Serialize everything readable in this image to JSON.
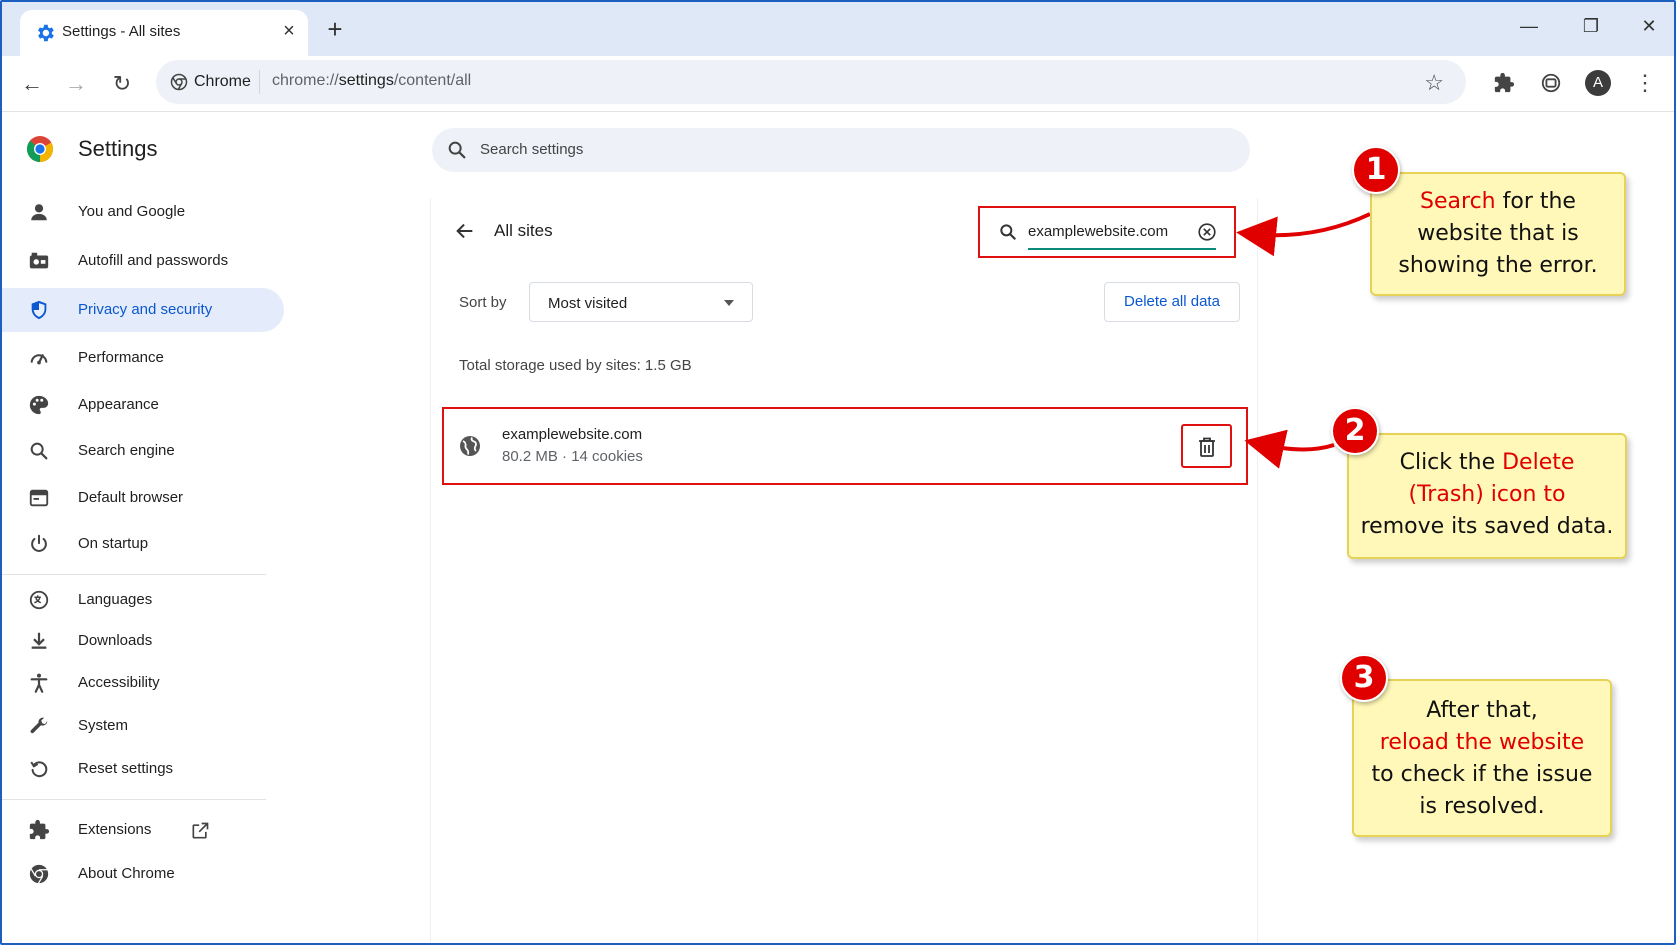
{
  "browser": {
    "tab_title": "Settings - All sites",
    "omnibox_chip": "Chrome",
    "url_prefix": "chrome://",
    "url_host": "settings",
    "url_path": "/content/all",
    "avatar_letter": "A"
  },
  "settings": {
    "title": "Settings",
    "search_placeholder": "Search settings",
    "sidebar": [
      {
        "label": "You and Google",
        "icon": "person-icon"
      },
      {
        "label": "Autofill and passwords",
        "icon": "autofill-icon"
      },
      {
        "label": "Privacy and security",
        "icon": "shield-icon",
        "active": true
      },
      {
        "label": "Performance",
        "icon": "speedometer-icon"
      },
      {
        "label": "Appearance",
        "icon": "palette-icon"
      },
      {
        "label": "Search engine",
        "icon": "search-icon"
      },
      {
        "label": "Default browser",
        "icon": "browser-window-icon"
      },
      {
        "label": "On startup",
        "icon": "power-icon"
      },
      {
        "label": "Languages",
        "icon": "translate-icon"
      },
      {
        "label": "Downloads",
        "icon": "download-icon"
      },
      {
        "label": "Accessibility",
        "icon": "accessibility-icon"
      },
      {
        "label": "System",
        "icon": "wrench-icon"
      },
      {
        "label": "Reset settings",
        "icon": "reset-icon"
      },
      {
        "label": "Extensions",
        "icon": "puzzle-icon"
      },
      {
        "label": "About Chrome",
        "icon": "chrome-icon"
      }
    ]
  },
  "all_sites": {
    "heading": "All sites",
    "search_value": "examplewebsite.com",
    "sort_label": "Sort by",
    "sort_value": "Most visited",
    "delete_all_label": "Delete all data",
    "total_storage": "Total storage used by sites: 1.5 GB",
    "site": {
      "name": "examplewebsite.com",
      "meta": "80.2 MB · 14 cookies"
    }
  },
  "callouts": [
    {
      "number": "1",
      "highlight": "Search",
      "text1": " for the",
      "text2": "website that is",
      "text3": "showing the error."
    },
    {
      "number": "2",
      "text1": "Click the ",
      "highlight1": "Delete",
      "highlight2": "(Trash) icon to",
      "text3": "remove its saved data."
    },
    {
      "number": "3",
      "text1": "After that,",
      "highlight": "reload the website",
      "text2": "to check if the issue",
      "text3": "is resolved."
    }
  ],
  "colors": {
    "accent_blue": "#0b57d0",
    "annotation_red": "#e00000",
    "callout_yellow": "#fff8b8"
  }
}
